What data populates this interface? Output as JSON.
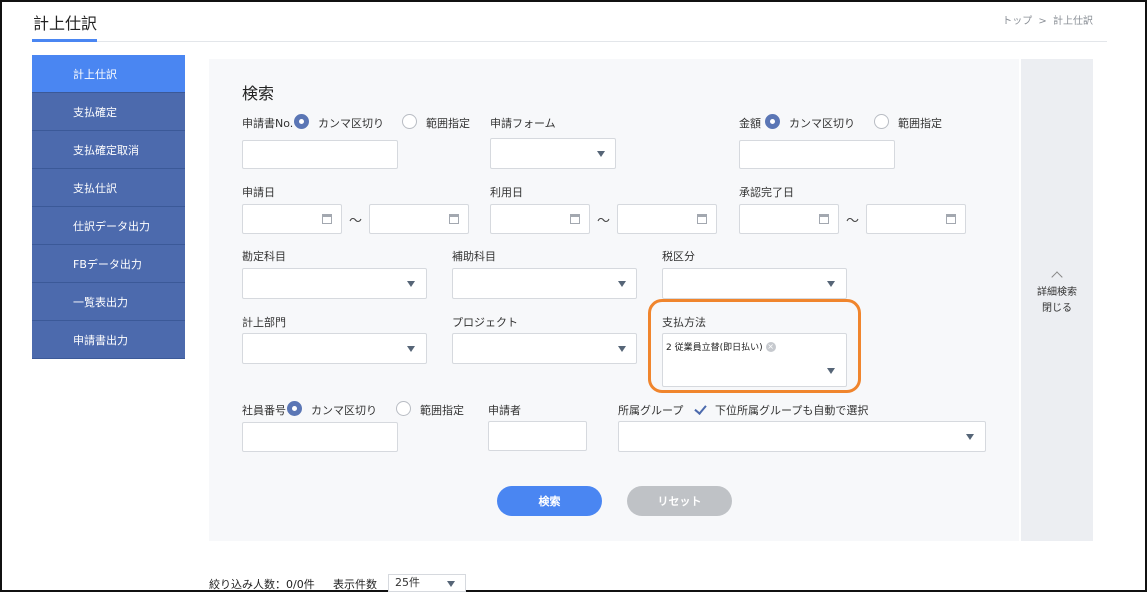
{
  "header": {
    "title": "計上仕訳",
    "breadcrumb": [
      "トップ",
      ">",
      "計上仕訳"
    ]
  },
  "sidebar": {
    "items": [
      {
        "label": "計上仕訳",
        "active": true
      },
      {
        "label": "支払確定",
        "active": false
      },
      {
        "label": "支払確定取消",
        "active": false
      },
      {
        "label": "支払仕訳",
        "active": false
      },
      {
        "label": "仕訳データ出力",
        "active": false
      },
      {
        "label": "FBデータ出力",
        "active": false
      },
      {
        "label": "一覧表出力",
        "active": false
      },
      {
        "label": "申請書出力",
        "active": false
      }
    ]
  },
  "search": {
    "title": "検索",
    "application_no": {
      "label": "申請書No.",
      "opt_comma": "カンマ区切り",
      "opt_range": "範囲指定",
      "value": ""
    },
    "application_form": {
      "label": "申請フォーム",
      "value": ""
    },
    "amount": {
      "label": "金額",
      "opt_comma": "カンマ区切り",
      "opt_range": "範囲指定",
      "value": ""
    },
    "application_date": {
      "label": "申請日",
      "tilde": "～"
    },
    "usage_date": {
      "label": "利用日",
      "tilde": "～"
    },
    "approval_date": {
      "label": "承認完了日",
      "tilde": "～"
    },
    "account_item": {
      "label": "勘定科目",
      "value": ""
    },
    "sub_account": {
      "label": "補助科目",
      "value": ""
    },
    "tax_category": {
      "label": "税区分",
      "value": ""
    },
    "department": {
      "label": "計上部門",
      "value": ""
    },
    "project": {
      "label": "プロジェクト",
      "value": ""
    },
    "payment_method": {
      "label": "支払方法",
      "chip": "2 従業員立替(即日払い)",
      "chip_remove": "×"
    },
    "employee_no": {
      "label": "社員番号",
      "opt_comma": "カンマ区切り",
      "opt_range": "範囲指定",
      "value": ""
    },
    "applicant": {
      "label": "申請者",
      "value": ""
    },
    "group": {
      "label": "所属グループ",
      "checkbox_label": "下位所属グループも自動で選択",
      "value": ""
    },
    "search_button": "検索",
    "reset_button": "リセット"
  },
  "detail_toggle": {
    "line1": "詳細検索",
    "line2": "閉じる"
  },
  "footer": {
    "filter_count": "絞り込み人数：0/0件",
    "display_count_label": "表示件数",
    "display_count_value": "25件"
  },
  "colors": {
    "accent": "#4a86f2",
    "sidebar": "#4c6aad",
    "highlight": "#f0852d"
  }
}
